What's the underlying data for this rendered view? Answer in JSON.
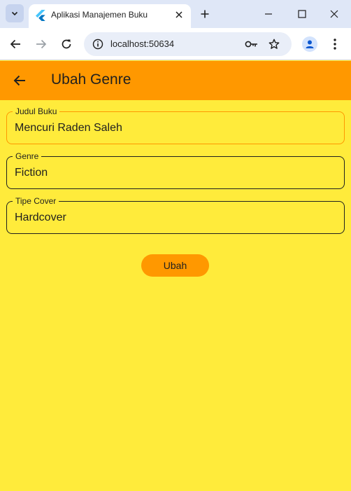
{
  "browser": {
    "tab": {
      "title": "Aplikasi Manajemen Buku",
      "favicon": "flutter-icon"
    },
    "url": "localhost:50634",
    "icons": [
      "tab-list-icon",
      "close-icon",
      "plus-icon",
      "minimize-icon",
      "maximize-icon",
      "window-close-icon",
      "back-arrow-icon",
      "forward-arrow-icon",
      "reload-icon",
      "site-info-icon",
      "key-icon",
      "star-icon",
      "profile-icon",
      "kebab-menu-icon"
    ]
  },
  "appbar": {
    "title": "Ubah Genre",
    "back_icon": "arrow-left-icon"
  },
  "form": {
    "fields": [
      {
        "label": "Judul Buku",
        "value": "Mencuri Raden Saleh"
      },
      {
        "label": "Genre",
        "value": "Fiction"
      },
      {
        "label": "Tipe Cover",
        "value": "Hardcover"
      }
    ],
    "submit_label": "Ubah"
  },
  "colors": {
    "appbar": "#ff9800",
    "background": "#ffeb3b",
    "button": "#ff9800",
    "tabstrip": "#dfe7f7"
  }
}
